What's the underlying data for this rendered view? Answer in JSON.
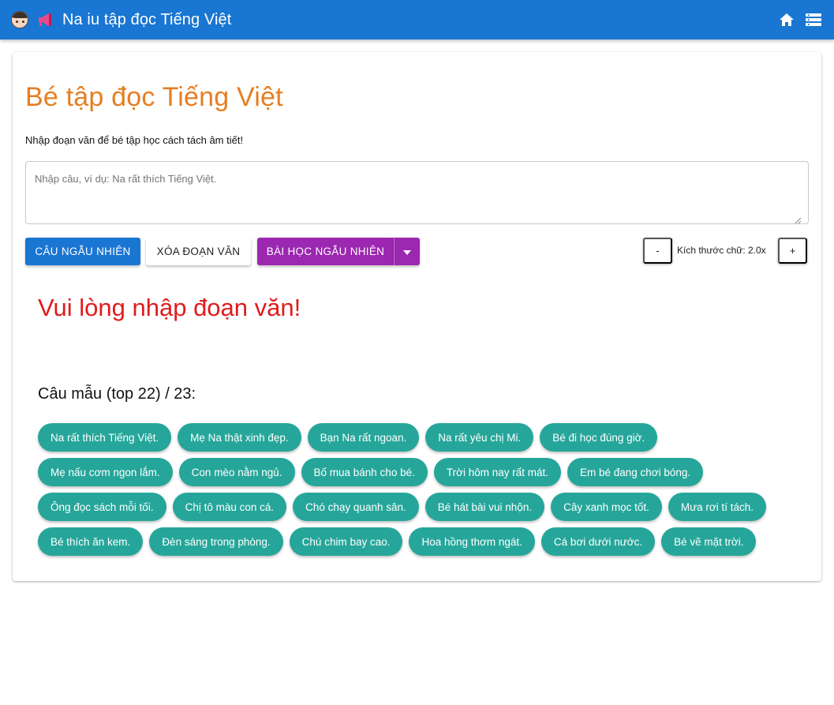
{
  "appbar": {
    "title": "Na iu tập đọc Tiếng Việt",
    "icons": [
      "girl-face-icon",
      "megaphone-icon",
      "home-icon",
      "menu-list-icon"
    ]
  },
  "main": {
    "heading": "Bé tập đọc Tiếng Việt",
    "subtitle": "Nhập đoạn văn để bé tập học cách tách âm tiết!",
    "input": {
      "value": "",
      "placeholder": "Nhập câu, ví dụ: Na rất thích Tiếng Việt."
    },
    "buttons": {
      "random_sentence": "Câu ngẫu nhiên",
      "clear_paragraph": "Xóa đoạn văn",
      "random_lesson": "Bài học ngẫu nhiên",
      "font_decrease": "-",
      "font_increase": "+"
    },
    "font_size_label": "Kích thước chữ: 2.0x",
    "warning": "Vui lòng nhập đoạn văn!",
    "samples_title": "Câu mẫu (top 22) / 23:",
    "samples": [
      "Na rất thích Tiếng Việt.",
      "Mẹ Na thật xinh đẹp.",
      "Bạn Na rất ngoan.",
      "Na rất yêu chị Mi.",
      "Bé đi học đúng giờ.",
      "Mẹ nấu cơm ngon lắm.",
      "Con mèo nằm ngủ.",
      "Bố mua bánh cho bé.",
      "Trời hôm nay rất mát.",
      "Em bé đang chơi bóng.",
      "Ông đọc sách mỗi tối.",
      "Chị tô màu con cá.",
      "Chó chạy quanh sân.",
      "Bé hát bài vui nhộn.",
      "Cây xanh mọc tốt.",
      "Mưa rơi tí tách.",
      "Bé thích ăn kem.",
      "Đèn sáng trong phòng.",
      "Chú chim bay cao.",
      "Hoa hồng thơm ngát.",
      "Cá bơi dưới nước.",
      "Bé vẽ mặt trời."
    ]
  },
  "colors": {
    "appbar": "#1976d2",
    "heading": "#e67e22",
    "primary_button": "#1976d2",
    "lesson_button": "#9c27b0",
    "warning": "#e01b1b",
    "chip": "#26a69a"
  }
}
